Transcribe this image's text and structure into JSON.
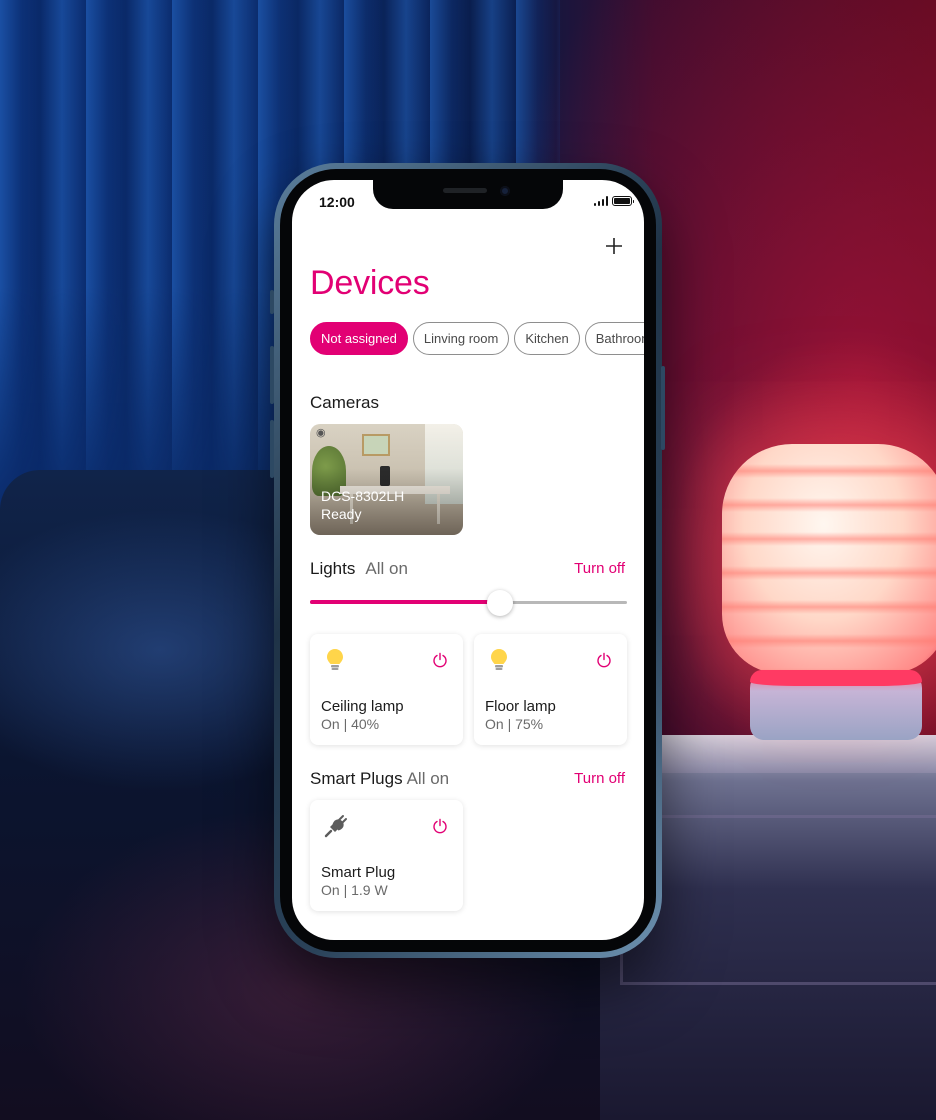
{
  "status_bar": {
    "time": "12:00"
  },
  "header": {
    "add_icon": "plus-icon",
    "title": "Devices"
  },
  "rooms": [
    {
      "label": "Not assigned",
      "active": true
    },
    {
      "label": "Linving room",
      "active": false
    },
    {
      "label": "Kitchen",
      "active": false
    },
    {
      "label": "Bathroom",
      "active": false
    }
  ],
  "cameras": {
    "title": "Cameras",
    "items": [
      {
        "name": "DCS-8302LH",
        "status": "Ready"
      }
    ]
  },
  "lights": {
    "title": "Lights",
    "summary": "All on",
    "action": "Turn off",
    "brightness_fraction": 0.6,
    "items": [
      {
        "name": "Ceiling lamp",
        "status": "On | 40%",
        "icon": "bulb-icon"
      },
      {
        "name": "Floor lamp",
        "status": "On | 75%",
        "icon": "bulb-icon"
      }
    ]
  },
  "smart_plugs": {
    "title": "Smart Plugs",
    "summary": "All on",
    "action": "Turn off",
    "items": [
      {
        "name": "Smart Plug",
        "status": "On | 1.9 W",
        "icon": "plug-icon"
      }
    ]
  },
  "colors": {
    "accent": "#e20074",
    "bulb": "#ffd54a",
    "text": "#1b1b1b",
    "muted": "#6a6a6a"
  }
}
